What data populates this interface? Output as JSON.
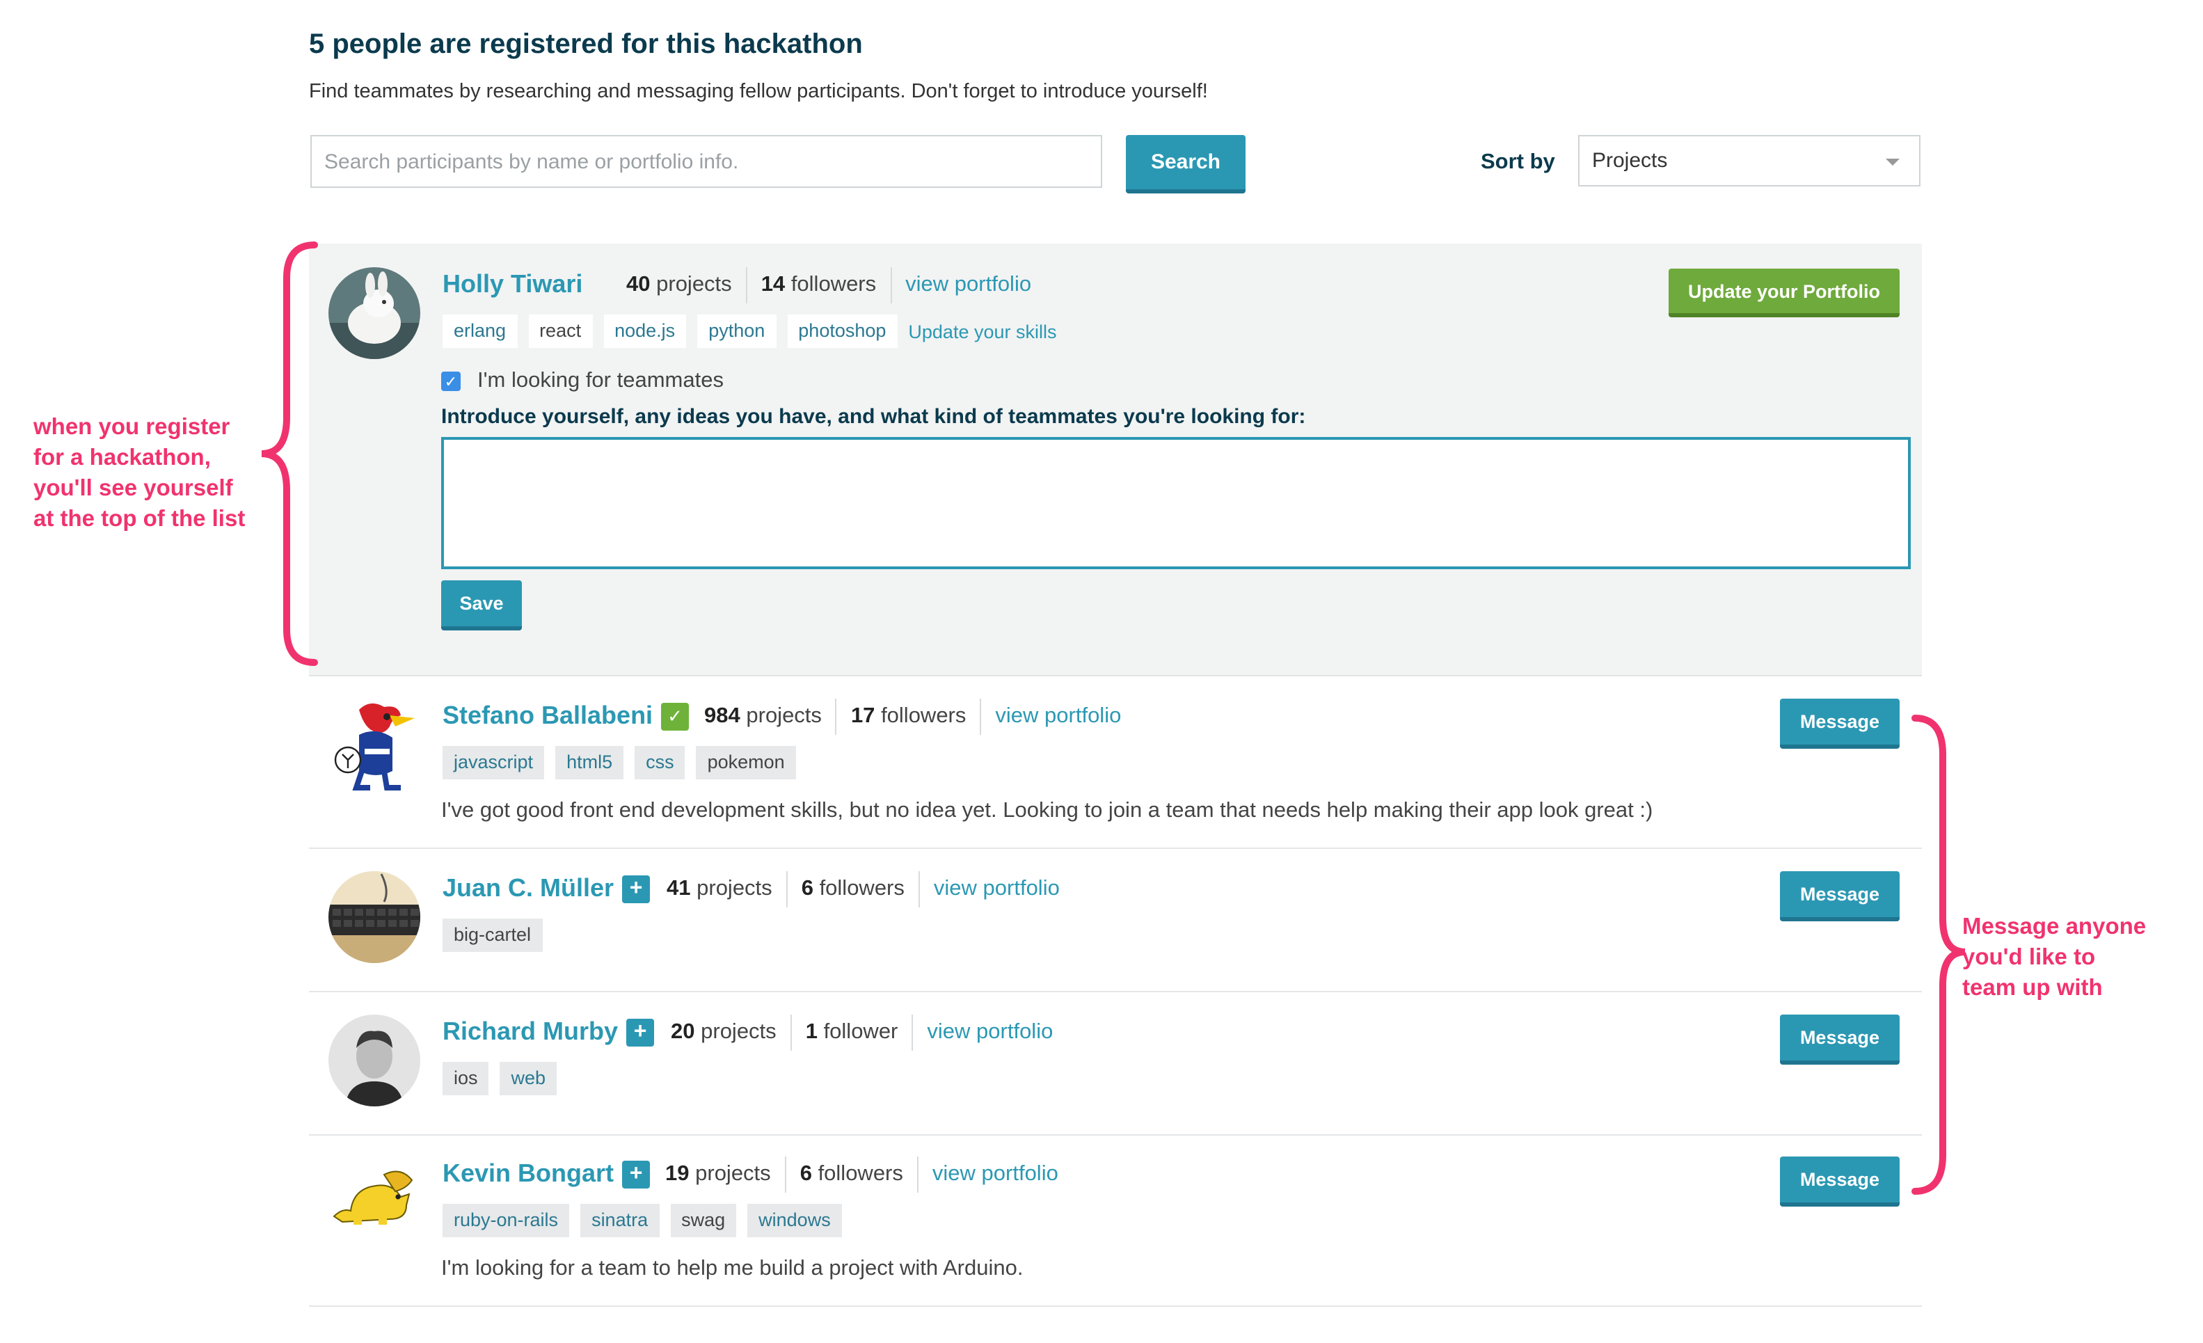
{
  "header": {
    "title": "5 people are registered for this hackathon",
    "subtitle": "Find teammates by researching and messaging fellow participants. Don't forget to introduce yourself!"
  },
  "search": {
    "placeholder": "Search participants by name or portfolio info.",
    "value": "",
    "button_label": "Search"
  },
  "sort": {
    "label": "Sort by",
    "selected": "Projects"
  },
  "self": {
    "name": "Holly Tiwari",
    "projects_count": "40",
    "projects_label": "projects",
    "followers_count": "14",
    "followers_label": "followers",
    "portfolio_link": "view portfolio",
    "tags": [
      "erlang",
      "react",
      "node.js",
      "python",
      "photoshop"
    ],
    "update_skills_link": "Update your skills",
    "update_button": "Update your Portfolio",
    "looking_label": "I'm looking for teammates",
    "intro_label": "Introduce yourself, any ideas you have, and what kind of teammates you're looking for:",
    "intro_value": "",
    "save_button": "Save"
  },
  "participants": [
    {
      "name": "Stefano Ballabeni",
      "badge": "check",
      "projects_count": "984",
      "projects_label": "projects",
      "followers_count": "17",
      "followers_label": "followers",
      "portfolio_link": "view portfolio",
      "tags": [
        "javascript",
        "html5",
        "css",
        "pokemon"
      ],
      "bio": "I've got good front end development skills, but no idea yet. Looking to join a team that needs help making their app look great :)",
      "message_button": "Message"
    },
    {
      "name": "Juan C. Müller",
      "badge": "plus",
      "projects_count": "41",
      "projects_label": "projects",
      "followers_count": "6",
      "followers_label": "followers",
      "portfolio_link": "view portfolio",
      "tags": [
        "big-cartel"
      ],
      "bio": "",
      "message_button": "Message"
    },
    {
      "name": "Richard Murby",
      "badge": "plus",
      "projects_count": "20",
      "projects_label": "projects",
      "followers_count": "1",
      "followers_label": "follower",
      "portfolio_link": "view portfolio",
      "tags": [
        "ios",
        "web"
      ],
      "bio": "",
      "message_button": "Message"
    },
    {
      "name": "Kevin Bongart",
      "badge": "plus",
      "projects_count": "19",
      "projects_label": "projects",
      "followers_count": "6",
      "followers_label": "followers",
      "portfolio_link": "view portfolio",
      "tags": [
        "ruby-on-rails",
        "sinatra",
        "swag",
        "windows"
      ],
      "bio": "I'm looking for a team to help me build a project with Arduino.",
      "message_button": "Message"
    }
  ],
  "annotations": {
    "left": [
      "when you register",
      "for a hackathon,",
      "you'll see yourself",
      "at the top of the list"
    ],
    "right": [
      "Message anyone",
      "you'd like to",
      "team up with"
    ]
  },
  "colors": {
    "accent": "#2b98b3",
    "green": "#6faa3c",
    "annotation": "#f0336e",
    "heading": "#0b3a4d"
  }
}
